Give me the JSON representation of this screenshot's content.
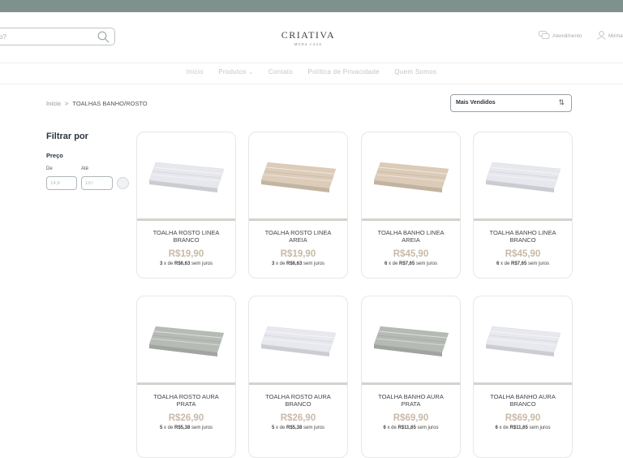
{
  "header": {
    "search_placeholder": "o?",
    "logo_main": "CRIATIVA",
    "logo_sub": "MODA CASA",
    "atendimento": "Atendimento",
    "minha_conta": "Minha"
  },
  "nav": {
    "items": [
      "Início",
      "Produtos",
      "Contato",
      "Política de Privacidade",
      "Quem Somos"
    ]
  },
  "breadcrumb": {
    "home": "Início",
    "sep": ">",
    "current": "TOALHAS BANHO/ROSTO"
  },
  "sort": {
    "selected": "Mais Vendidos"
  },
  "filter": {
    "title": "Filtrar por",
    "price_title": "Preço",
    "from_label": "De",
    "to_label": "Até",
    "from_placeholder": "14,9",
    "to_placeholder": "197"
  },
  "products": [
    {
      "name": "TOALHA ROSTO LINEA BRANCO",
      "price": "R$19,90",
      "inst_n": "3",
      "inst_x": " x de ",
      "inst_val": "R$6,63",
      "inst_suffix": " sem juros",
      "color": "#e7e8ee"
    },
    {
      "name": "TOALHA ROSTO LINEA AREIA",
      "price": "R$19,90",
      "inst_n": "3",
      "inst_x": " x de ",
      "inst_val": "R$6,63",
      "inst_suffix": " sem juros",
      "color": "#dcccb8"
    },
    {
      "name": "TOALHA BANHO LINEA AREIA",
      "price": "R$45,90",
      "inst_n": "6",
      "inst_x": " x de ",
      "inst_val": "R$7,65",
      "inst_suffix": " sem juros",
      "color": "#dccbb7"
    },
    {
      "name": "TOALHA BANHO LINEA BRANCO",
      "price": "R$45,90",
      "inst_n": "6",
      "inst_x": " x de ",
      "inst_val": "R$7,65",
      "inst_suffix": " sem juros",
      "color": "#e7e8ee"
    },
    {
      "name": "TOALHA ROSTO AURA PRATA",
      "price": "R$26,90",
      "inst_n": "5",
      "inst_x": " x de ",
      "inst_val": "R$5,38",
      "inst_suffix": " sem juros",
      "color": "#b6bbb5"
    },
    {
      "name": "TOALHA ROSTO AURA BRANCO",
      "price": "R$26,90",
      "inst_n": "5",
      "inst_x": " x de ",
      "inst_val": "R$5,38",
      "inst_suffix": " sem juros",
      "color": "#e8e9ef"
    },
    {
      "name": "TOALHA BANHO AURA PRATA",
      "price": "R$69,90",
      "inst_n": "6",
      "inst_x": " x de ",
      "inst_val": "R$11,65",
      "inst_suffix": " sem juros",
      "color": "#b5bab4"
    },
    {
      "name": "TOALHA BANHO AURA BRANCO",
      "price": "R$69,90",
      "inst_n": "6",
      "inst_x": " x de ",
      "inst_val": "R$11,65",
      "inst_suffix": " sem juros",
      "color": "#e8e9ef"
    }
  ],
  "colors": {
    "topbar": "#7f918c",
    "price": "#c8b9a8",
    "heading": "#2c3440"
  }
}
